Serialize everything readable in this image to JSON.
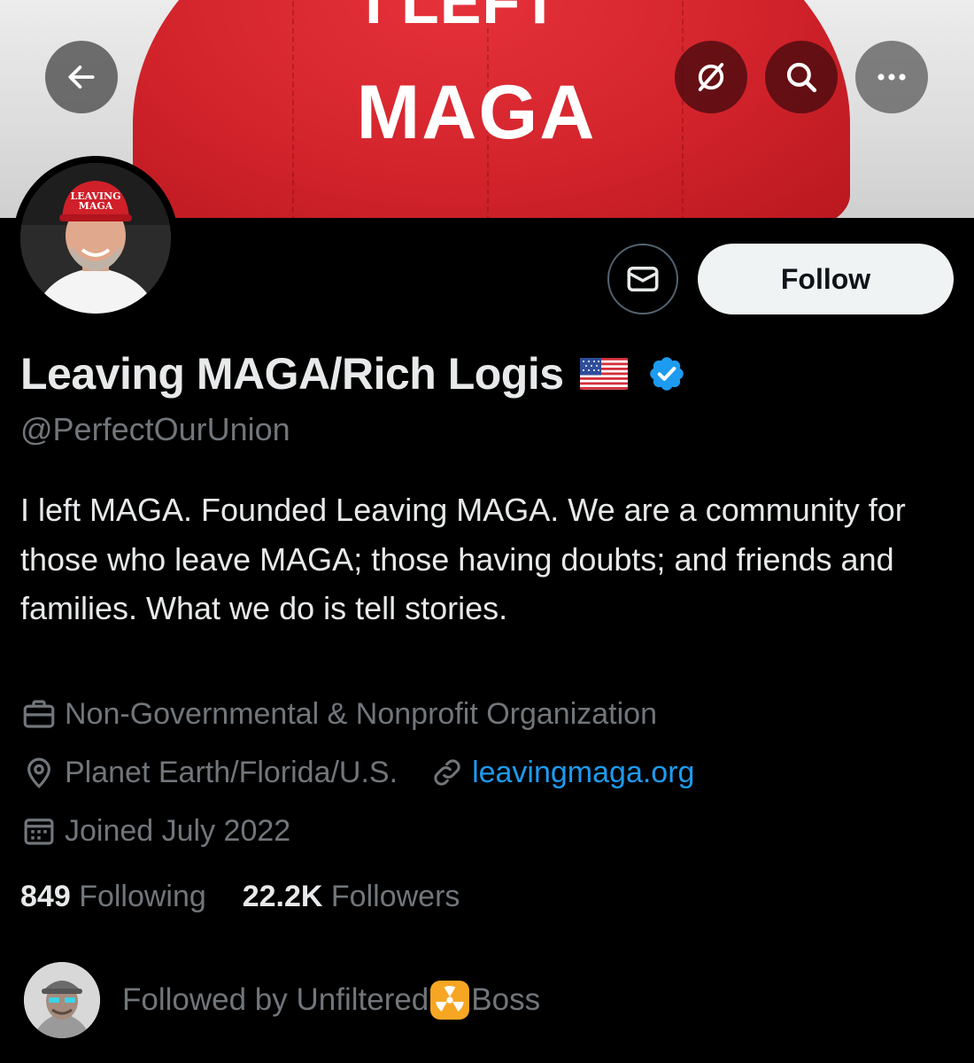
{
  "banner": {
    "cap_text_line1": "I LEFT",
    "cap_text_line2": "MAGA"
  },
  "toolbar": {
    "back_icon": "arrow-left-icon",
    "translate_icon": "translate-icon",
    "search_icon": "search-icon",
    "more_icon": "more-icon"
  },
  "avatar": {
    "cap_text_line1": "LEAVING",
    "cap_text_line2": "MAGA"
  },
  "actions": {
    "message_icon": "envelope-icon",
    "follow_label": "Follow"
  },
  "profile": {
    "display_name": "Leaving MAGA/Rich Logis",
    "handle": "@PerfectOurUnion",
    "bio": "I left MAGA. Founded Leaving MAGA. We are a community for those who leave MAGA; those having doubts; and friends and families. What we do is tell stories.",
    "category": "Non-Governmental & Nonprofit Organization",
    "location": "Planet Earth/Florida/U.S.",
    "website": "leavingmaga.org",
    "joined": "Joined July 2022"
  },
  "stats": {
    "following_count": "849",
    "following_label": "Following",
    "followers_count": "22.2K",
    "followers_label": "Followers"
  },
  "followed_by": {
    "prefix": "Followed by Unfiltered",
    "suffix": "Boss"
  },
  "colors": {
    "background": "#000000",
    "text_primary": "#e7e9ea",
    "text_secondary": "#71767b",
    "link": "#1d9bf0",
    "verified": "#1d9bf0",
    "follow_button_bg": "#eff3f4"
  }
}
